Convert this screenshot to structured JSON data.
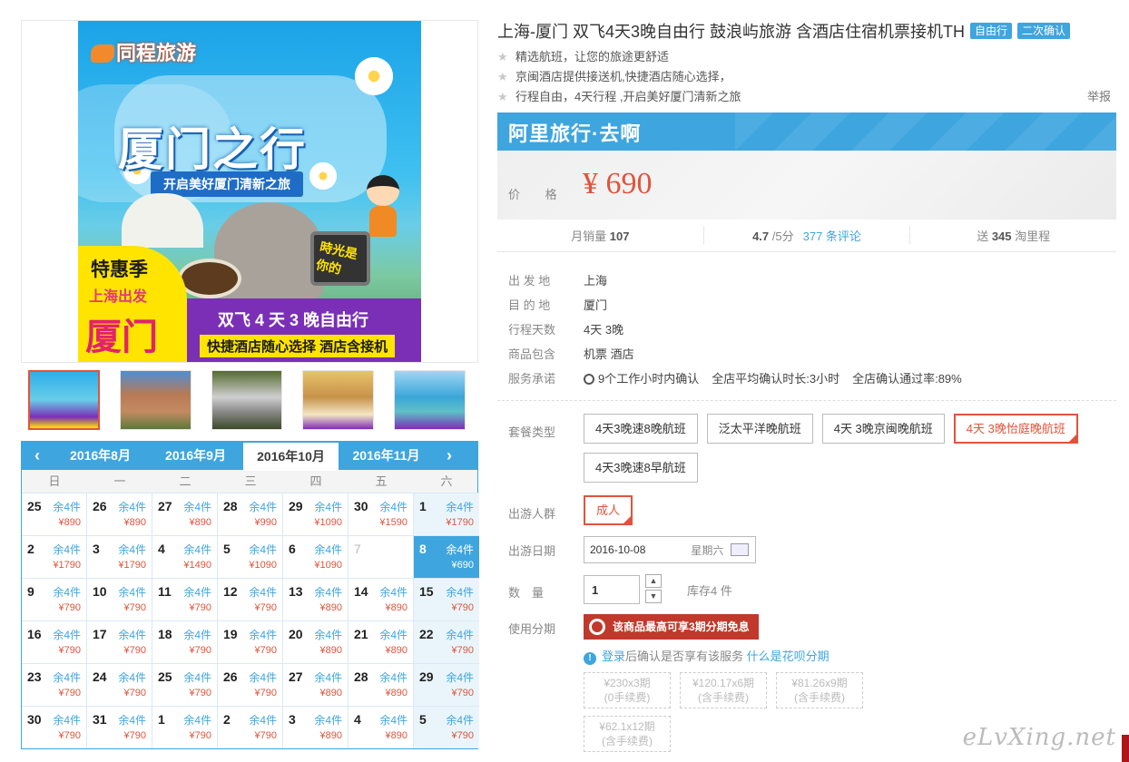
{
  "hero": {
    "logo_text": "同程旅游",
    "title": "厦门之行",
    "subtitle": "开启美好厦门清新之旅",
    "badge_line1": "特惠季",
    "badge_line2": "上海出发",
    "badge_line3": "厦门",
    "band_line1": "双飞 4 天 3 晚自由行",
    "band_line2": "快捷酒店随心选择  酒店含接机",
    "tv_text": "時光是你的"
  },
  "thumbnails": [
    "poster",
    "apartment",
    "statue",
    "hotel-room",
    "beach"
  ],
  "calendar": {
    "prev_icon": "‹",
    "next_icon": "›",
    "months": [
      "2016年8月",
      "2016年9月",
      "2016年10月",
      "2016年11月"
    ],
    "active_month_index": 2,
    "weekdays": [
      "日",
      "一",
      "二",
      "三",
      "四",
      "五",
      "六"
    ],
    "cells": [
      {
        "d": "25",
        "s": "余4件",
        "p": "¥890"
      },
      {
        "d": "26",
        "s": "余4件",
        "p": "¥890"
      },
      {
        "d": "27",
        "s": "余4件",
        "p": "¥890"
      },
      {
        "d": "28",
        "s": "余4件",
        "p": "¥990"
      },
      {
        "d": "29",
        "s": "余4件",
        "p": "¥1090"
      },
      {
        "d": "30",
        "s": "余4件",
        "p": "¥1590"
      },
      {
        "d": "1",
        "s": "余4件",
        "p": "¥1790"
      },
      {
        "d": "2",
        "s": "余4件",
        "p": "¥1790"
      },
      {
        "d": "3",
        "s": "余4件",
        "p": "¥1790"
      },
      {
        "d": "4",
        "s": "余4件",
        "p": "¥1490"
      },
      {
        "d": "5",
        "s": "余4件",
        "p": "¥1090"
      },
      {
        "d": "6",
        "s": "余4件",
        "p": "¥1090"
      },
      {
        "d": "7",
        "s": "",
        "p": "",
        "gray": true
      },
      {
        "d": "8",
        "s": "余4件",
        "p": "¥690",
        "selected": true
      },
      {
        "d": "9",
        "s": "余4件",
        "p": "¥790"
      },
      {
        "d": "10",
        "s": "余4件",
        "p": "¥790"
      },
      {
        "d": "11",
        "s": "余4件",
        "p": "¥790"
      },
      {
        "d": "12",
        "s": "余4件",
        "p": "¥790"
      },
      {
        "d": "13",
        "s": "余4件",
        "p": "¥890"
      },
      {
        "d": "14",
        "s": "余4件",
        "p": "¥890"
      },
      {
        "d": "15",
        "s": "余4件",
        "p": "¥790"
      },
      {
        "d": "16",
        "s": "余4件",
        "p": "¥790"
      },
      {
        "d": "17",
        "s": "余4件",
        "p": "¥790"
      },
      {
        "d": "18",
        "s": "余4件",
        "p": "¥790"
      },
      {
        "d": "19",
        "s": "余4件",
        "p": "¥790"
      },
      {
        "d": "20",
        "s": "余4件",
        "p": "¥890"
      },
      {
        "d": "21",
        "s": "余4件",
        "p": "¥890"
      },
      {
        "d": "22",
        "s": "余4件",
        "p": "¥790"
      },
      {
        "d": "23",
        "s": "余4件",
        "p": "¥790"
      },
      {
        "d": "24",
        "s": "余4件",
        "p": "¥790"
      },
      {
        "d": "25",
        "s": "余4件",
        "p": "¥790"
      },
      {
        "d": "26",
        "s": "余4件",
        "p": "¥790"
      },
      {
        "d": "27",
        "s": "余4件",
        "p": "¥890"
      },
      {
        "d": "28",
        "s": "余4件",
        "p": "¥890"
      },
      {
        "d": "29",
        "s": "余4件",
        "p": "¥790"
      },
      {
        "d": "30",
        "s": "余4件",
        "p": "¥790"
      },
      {
        "d": "31",
        "s": "余4件",
        "p": "¥790"
      },
      {
        "d": "1",
        "s": "余4件",
        "p": "¥790"
      },
      {
        "d": "2",
        "s": "余4件",
        "p": "¥790"
      },
      {
        "d": "3",
        "s": "余4件",
        "p": "¥890"
      },
      {
        "d": "4",
        "s": "余4件",
        "p": "¥890"
      },
      {
        "d": "5",
        "s": "余4件",
        "p": "¥790"
      }
    ]
  },
  "product": {
    "title": "上海-厦门 双飞4天3晚自由行 鼓浪屿旅游 含酒店住宿机票接机TH",
    "tags": [
      "自由行",
      "二次确认"
    ],
    "points": [
      "精选航班，让您的旅途更舒适",
      "京闽酒店提供接送机,快捷酒店随心选择，",
      "行程自由，4天行程 ,开启美好厦门清新之旅"
    ],
    "report_label": "举报",
    "brand": "阿里旅行·去啊",
    "price_label": "价 格",
    "price": "¥ 690",
    "monthly_sales_label": "月销量",
    "monthly_sales": "107",
    "rating": "4.7",
    "rating_suffix": "/5分",
    "reviews": "377 条评论",
    "points_prefix": "送",
    "points_value": "345",
    "points_suffix": "淘里程"
  },
  "info": [
    {
      "k": "出 发 地",
      "v": "上海"
    },
    {
      "k": "目 的 地",
      "v": "厦门"
    },
    {
      "k": "行程天数",
      "v": "4天 3晚"
    },
    {
      "k": "商品包含",
      "v": "机票  酒店"
    }
  ],
  "service": {
    "label": "服务承诺",
    "items": [
      "9个工作小时内确认",
      "全店平均确认时长:3小时",
      "全店确认通过率:89%"
    ]
  },
  "options": {
    "package_label": "套餐类型",
    "packages": [
      "4天3晚速8晚航班",
      "泛太平洋晚航班",
      "4天 3晚京闽晚航班",
      "4天 3晚怡庭晚航班",
      "4天3晚速8早航班"
    ],
    "package_selected": 3,
    "people_label": "出游人群",
    "people": "成人",
    "date_label": "出游日期",
    "date_value": "2016-10-08",
    "date_weekday": "星期六",
    "qty_label": "数　量",
    "qty_value": "1",
    "stock": "库存4 件",
    "installment_label": "使用分期",
    "huabei_banner": "该商品最高可享3期分期免息",
    "huabei_note_link1": "登录",
    "huabei_note_mid": "后确认是否享有该服务",
    "huabei_note_link2": "什么是花呗分期",
    "plans": [
      {
        "a": "¥230x3期",
        "b": "(0手续费)"
      },
      {
        "a": "¥120.17x6期",
        "b": "(含手续费)"
      },
      {
        "a": "¥81.26x9期",
        "b": "(含手续费)"
      },
      {
        "a": "¥62.1x12期",
        "b": "(含手续费)"
      }
    ]
  },
  "watermark": "eLvXing.net",
  "colors": {
    "accent": "#3ea5df",
    "price": "#e0543c",
    "huabei": "#c0392b"
  }
}
